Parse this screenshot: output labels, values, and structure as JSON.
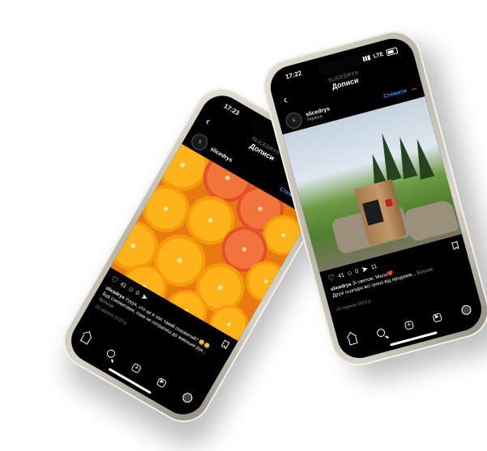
{
  "phones": [
    {
      "id": "left",
      "status": {
        "time": "17:23"
      },
      "nav": {
        "account": "SLICEDRYS",
        "title": "Дописи"
      },
      "post": {
        "username": "slicedrys",
        "follow_label": "Стежити",
        "likes": "41",
        "comments": "0",
        "caption_user": "slicedrys",
        "caption_text": "Уууух, хто це в нас такий соковитий? 😋😋",
        "caption_more_text": "Буд соковитими, поки не потрапиш до жменьки рук...",
        "more_label": "Більше",
        "date": "22 серпня 2023 р."
      }
    },
    {
      "id": "right",
      "status": {
        "time": "17:22",
        "network": "LTE"
      },
      "nav": {
        "account": "SLICEDRYS",
        "title": "Дописи"
      },
      "post": {
        "username": "slicedrys",
        "location": "Україна",
        "follow_label": "Стежити",
        "likes": "41",
        "comments": "0",
        "shares": "11",
        "caption_user": "slicedrys",
        "caption_text": "Зі святом, Мала❤️",
        "caption_more_text": "Друзі сьогодні всі гроші від продажів...",
        "more_label": "Більше",
        "date": "24 серпня 2023 р."
      }
    }
  ]
}
